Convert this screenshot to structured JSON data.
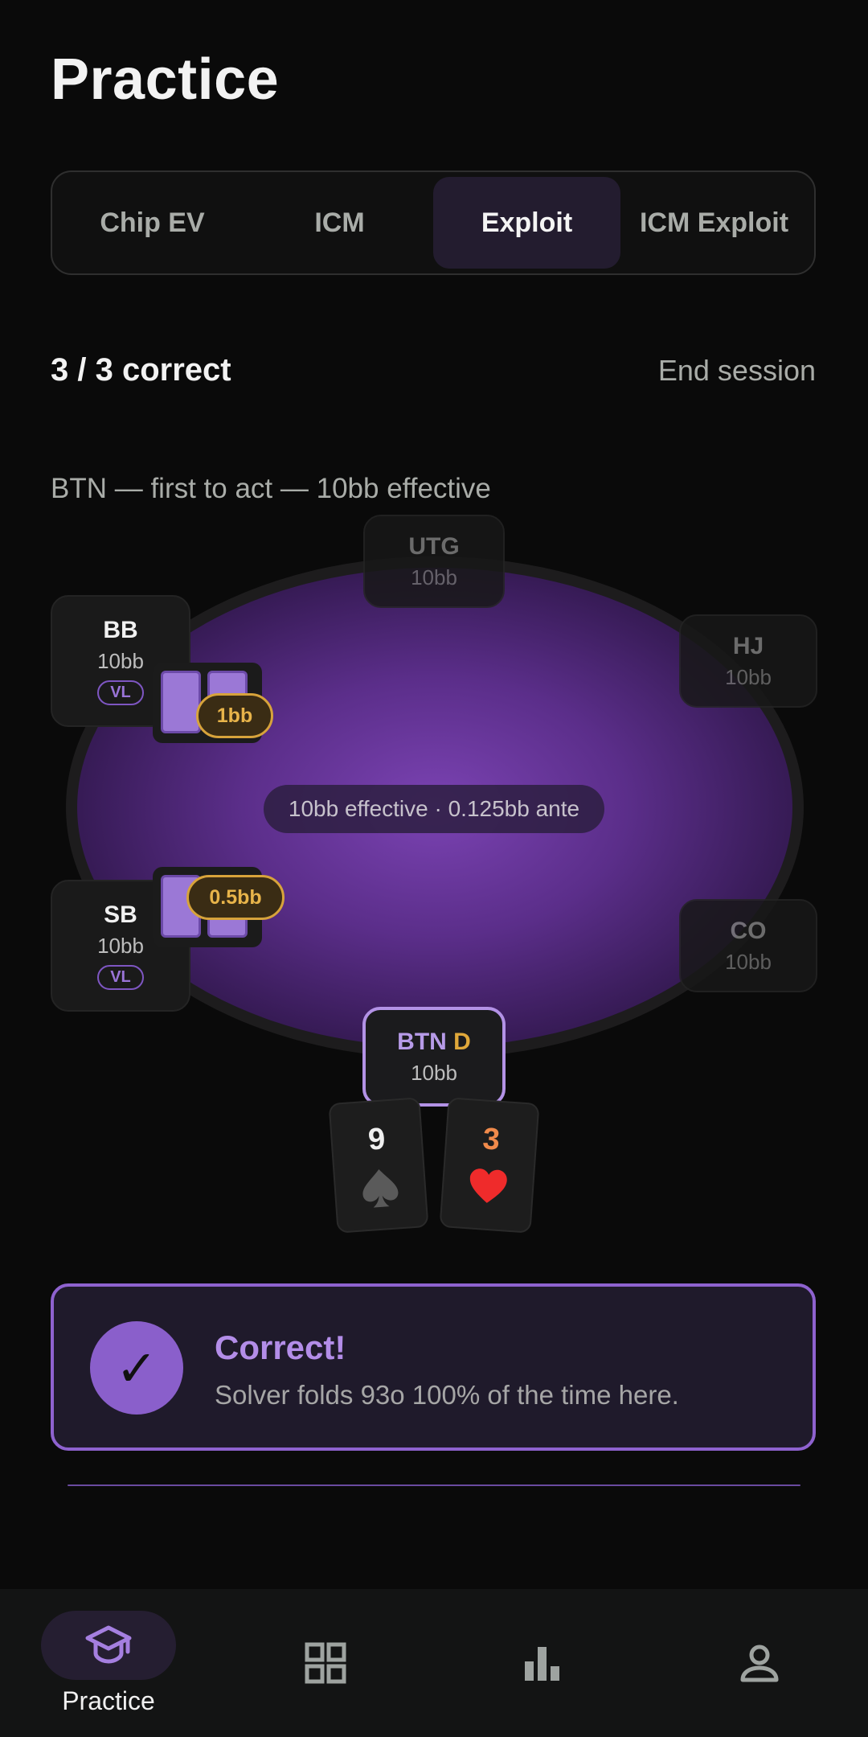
{
  "header": {
    "title": "Practice"
  },
  "tabs": [
    {
      "label": "Chip EV",
      "active": false
    },
    {
      "label": "ICM",
      "active": false
    },
    {
      "label": "Exploit",
      "active": true
    },
    {
      "label": "ICM Exploit",
      "active": false
    }
  ],
  "session": {
    "score": "3 / 3 correct",
    "end_label": "End session"
  },
  "scenario": "BTN — first to act — 10bb effective",
  "table": {
    "pot_info": "10bb effective · 0.125bb ante",
    "seats": {
      "utg": {
        "name": "UTG",
        "stack": "10bb"
      },
      "hj": {
        "name": "HJ",
        "stack": "10bb"
      },
      "co": {
        "name": "CO",
        "stack": "10bb"
      },
      "bb": {
        "name": "BB",
        "stack": "10bb",
        "badge": "VL",
        "bet": "1bb"
      },
      "sb": {
        "name": "SB",
        "stack": "10bb",
        "badge": "VL",
        "bet": "0.5bb"
      },
      "btn": {
        "name": "BTN",
        "dealer": "D",
        "stack": "10bb"
      }
    },
    "hero_cards": [
      {
        "rank": "9",
        "suit": "spade-icon",
        "color": "#f0f0f0"
      },
      {
        "rank": "3",
        "suit": "heart-icon",
        "color": "#f08a4b"
      }
    ]
  },
  "result": {
    "title": "Correct!",
    "message": "Solver folds 93o 100% of the time here."
  },
  "nav": [
    {
      "label": "Practice",
      "icon": "graduation-cap-icon",
      "active": true
    },
    {
      "label": "",
      "icon": "grid-icon",
      "active": false
    },
    {
      "label": "",
      "icon": "bar-chart-icon",
      "active": false
    },
    {
      "label": "",
      "icon": "user-icon",
      "active": false
    }
  ],
  "colors": {
    "accent": "#8a5fcb",
    "accent_light": "#b38de8",
    "chip": "#e0a83a",
    "background": "#0a0a0a"
  }
}
